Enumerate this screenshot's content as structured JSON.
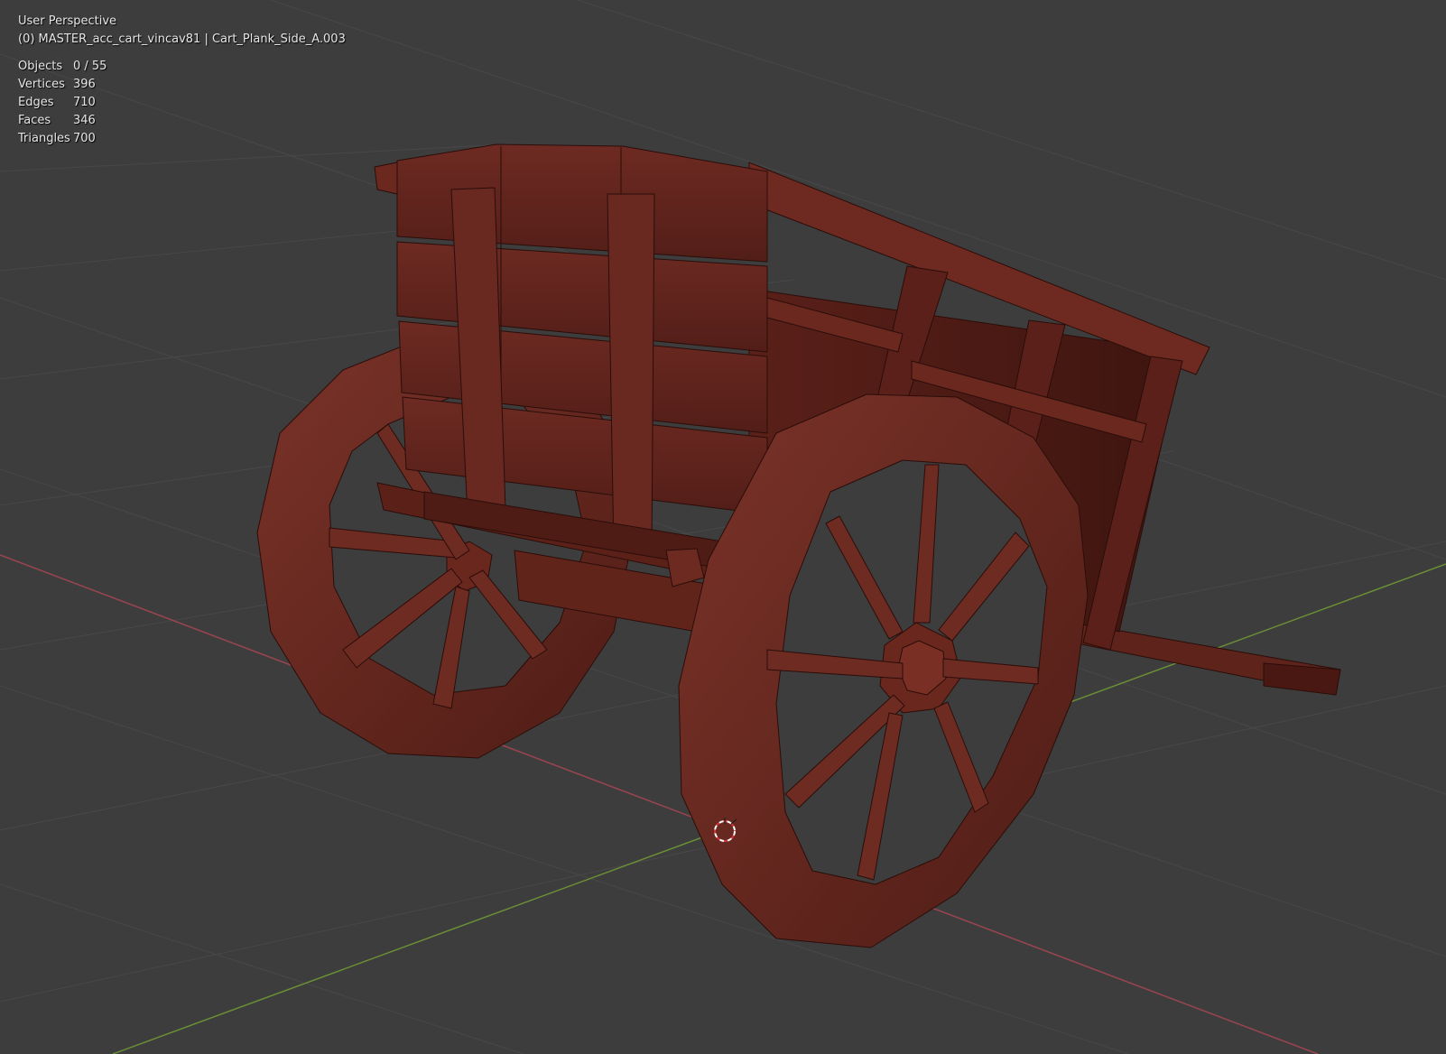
{
  "viewport": {
    "view_name": "User Perspective",
    "object_info": "(0) MASTER_acc_cart_vincav81 | Cart_Plank_Side_A.003"
  },
  "stats": [
    {
      "label": "Objects",
      "value": "0 / 55"
    },
    {
      "label": "Vertices",
      "value": "396"
    },
    {
      "label": "Edges",
      "value": "710"
    },
    {
      "label": "Faces",
      "value": "346"
    },
    {
      "label": "Triangles",
      "value": "700"
    }
  ],
  "colors": {
    "background": "#3d3d3d",
    "grid_line": "#4a4a4a",
    "x_axis": "#9a4550",
    "y_axis": "#6a8f35",
    "mesh_base": "#6a2a22",
    "mesh_dark": "#3a140f",
    "mesh_light": "#8a3a2f",
    "text": "#e6e6e6"
  },
  "icons": {
    "cursor": "3d-cursor-icon"
  }
}
